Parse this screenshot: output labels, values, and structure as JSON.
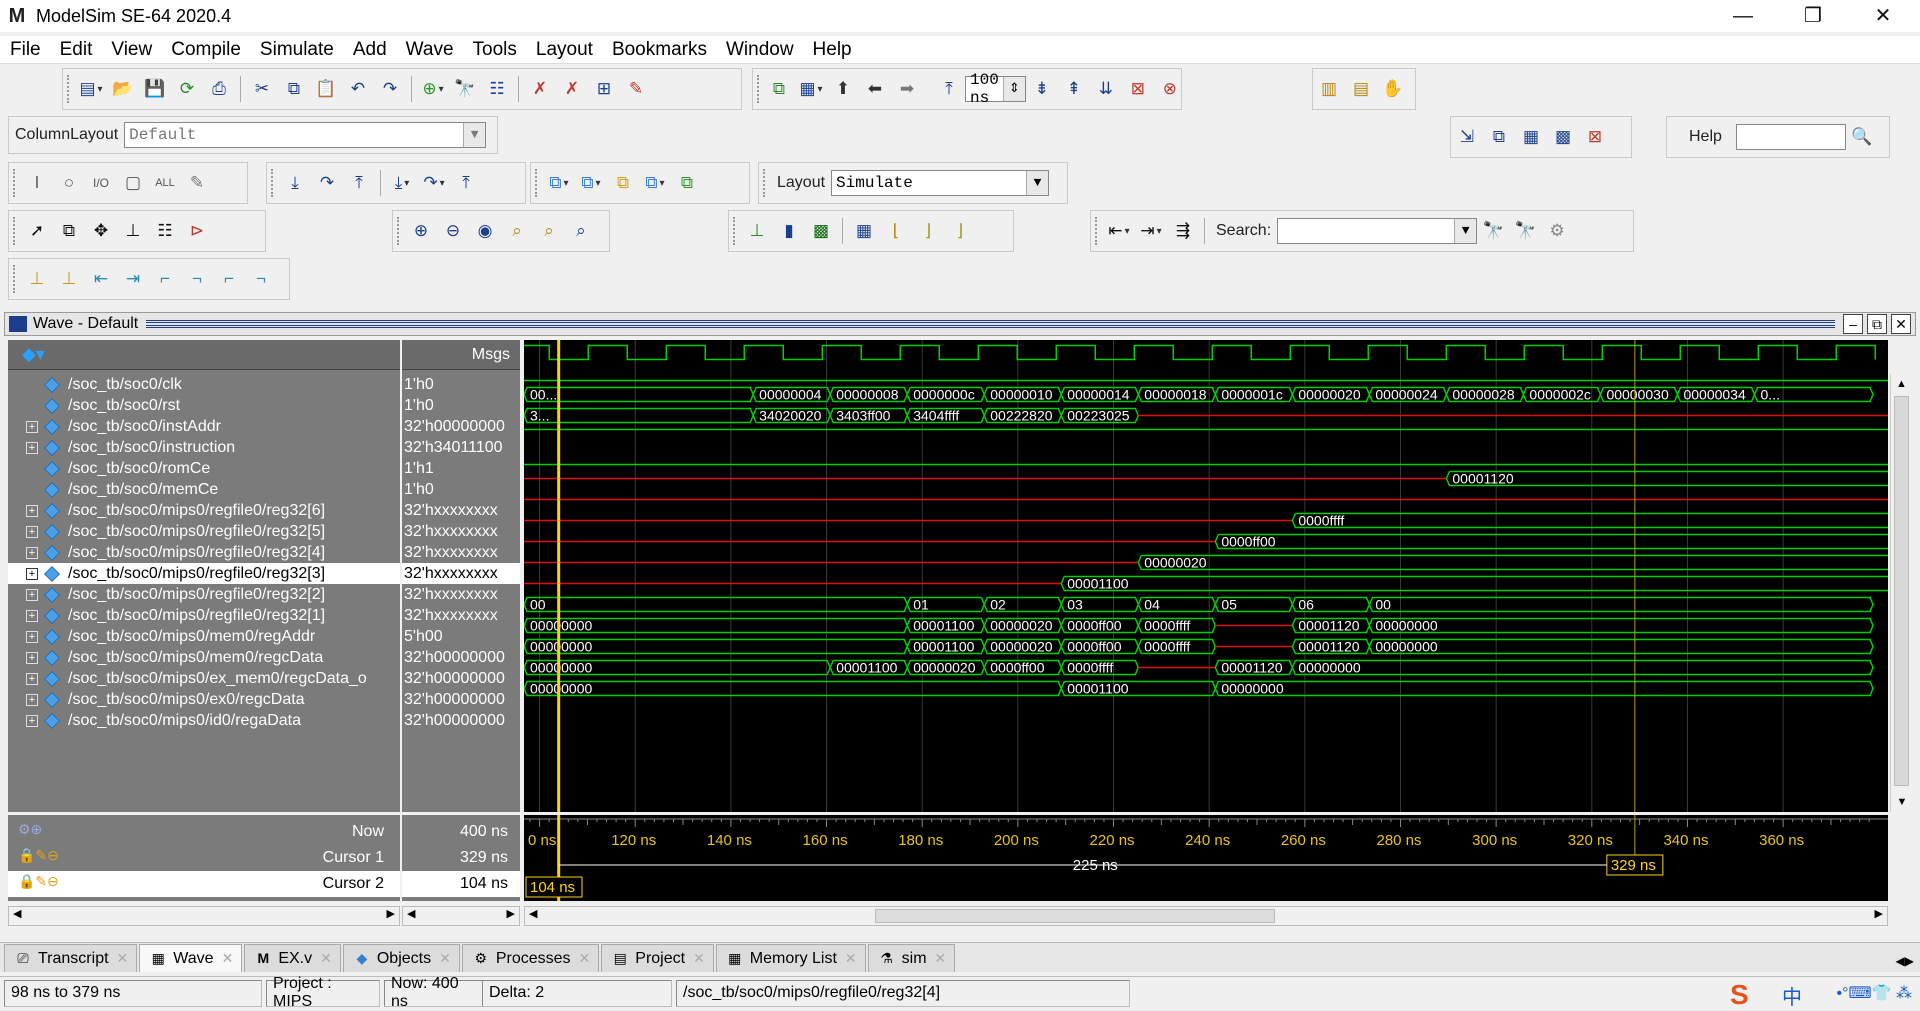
{
  "window": {
    "title": "ModelSim SE-64 2020.4"
  },
  "menu": [
    "File",
    "Edit",
    "View",
    "Compile",
    "Simulate",
    "Add",
    "Wave",
    "Tools",
    "Layout",
    "Bookmarks",
    "Window",
    "Help"
  ],
  "toolbar": {
    "run_length": "100 ns",
    "column_layout_label": "ColumnLayout",
    "column_layout_value": "Default",
    "layout_label": "Layout",
    "layout_value": "Simulate",
    "search_label": "Search:",
    "search_value": "",
    "help_label": "Help",
    "help_value": ""
  },
  "wave_window": {
    "title": "Wave - Default",
    "msgs_header": "Msgs",
    "signals": [
      {
        "name": "/soc_tb/soc0/clk",
        "value": "1'h0",
        "expandable": false
      },
      {
        "name": "/soc_tb/soc0/rst",
        "value": "1'h0",
        "expandable": false
      },
      {
        "name": "/soc_tb/soc0/instAddr",
        "value": "32'h00000000",
        "expandable": true
      },
      {
        "name": "/soc_tb/soc0/instruction",
        "value": "32'h34011100",
        "expandable": true
      },
      {
        "name": "/soc_tb/soc0/romCe",
        "value": "1'h1",
        "expandable": false
      },
      {
        "name": "/soc_tb/soc0/memCe",
        "value": "1'h0",
        "expandable": false
      },
      {
        "name": "/soc_tb/soc0/mips0/regfile0/reg32[6]",
        "value": "32'hxxxxxxxx",
        "expandable": true
      },
      {
        "name": "/soc_tb/soc0/mips0/regfile0/reg32[5]",
        "value": "32'hxxxxxxxx",
        "expandable": true
      },
      {
        "name": "/soc_tb/soc0/mips0/regfile0/reg32[4]",
        "value": "32'hxxxxxxxx",
        "expandable": true
      },
      {
        "name": "/soc_tb/soc0/mips0/regfile0/reg32[3]",
        "value": "32'hxxxxxxxx",
        "expandable": true,
        "selected": true
      },
      {
        "name": "/soc_tb/soc0/mips0/regfile0/reg32[2]",
        "value": "32'hxxxxxxxx",
        "expandable": true
      },
      {
        "name": "/soc_tb/soc0/mips0/regfile0/reg32[1]",
        "value": "32'hxxxxxxxx",
        "expandable": true
      },
      {
        "name": "/soc_tb/soc0/mips0/mem0/regAddr",
        "value": "5'h00",
        "expandable": true
      },
      {
        "name": "/soc_tb/soc0/mips0/mem0/regcData",
        "value": "32'h00000000",
        "expandable": true
      },
      {
        "name": "/soc_tb/soc0/mips0/ex_mem0/regcData_o",
        "value": "32'h00000000",
        "expandable": true
      },
      {
        "name": "/soc_tb/soc0/mips0/ex0/regcData",
        "value": "32'h00000000",
        "expandable": true
      },
      {
        "name": "/soc_tb/soc0/mips0/id0/regaData",
        "value": "32'h00000000",
        "expandable": true
      }
    ],
    "waves": [
      {
        "kind": "clock"
      },
      {
        "kind": "low"
      },
      {
        "kind": "bus",
        "color": "green",
        "segs": [
          [
            -10,
            113,
            "00..."
          ],
          [
            113,
            152,
            "00000004"
          ],
          [
            152,
            191,
            "00000008"
          ],
          [
            191,
            230,
            "0000000c"
          ],
          [
            230,
            269,
            "00000010"
          ],
          [
            269,
            308,
            "00000014"
          ],
          [
            308,
            347,
            "00000018"
          ],
          [
            347,
            386,
            "0000001c"
          ],
          [
            386,
            425,
            "00000020"
          ],
          [
            425,
            464,
            "00000024"
          ],
          [
            464,
            503,
            "00000028"
          ],
          [
            503,
            542,
            "0000002c"
          ],
          [
            542,
            581,
            "00000030"
          ],
          [
            581,
            620,
            "00000034"
          ],
          [
            620,
            680,
            "0..."
          ]
        ]
      },
      {
        "kind": "bus",
        "color": "green",
        "segs": [
          [
            -10,
            113,
            "3..."
          ],
          [
            113,
            152,
            "34020020"
          ],
          [
            152,
            191,
            "3403ff00"
          ],
          [
            191,
            230,
            "3404ffff"
          ],
          [
            230,
            269,
            "00222820"
          ],
          [
            269,
            308,
            "00223025"
          ]
        ],
        "tail": "red",
        "tail_from": 308
      },
      {
        "kind": "high"
      },
      {
        "kind": "low"
      },
      {
        "kind": "bus",
        "color": "red",
        "segs": [],
        "tail": "green",
        "tail_from": 464,
        "tail_label": "00001120"
      },
      {
        "kind": "bus",
        "color": "red",
        "segs": []
      },
      {
        "kind": "bus",
        "color": "red",
        "segs": [],
        "tail": "green",
        "tail_from": 386,
        "tail_label": "0000ffff"
      },
      {
        "kind": "bus",
        "color": "red",
        "segs": [],
        "tail": "green",
        "tail_from": 347,
        "tail_label": "0000ff00"
      },
      {
        "kind": "bus",
        "color": "red",
        "segs": [],
        "tail": "green",
        "tail_from": 308,
        "tail_label": "00000020"
      },
      {
        "kind": "bus",
        "color": "red",
        "segs": [],
        "tail": "green",
        "tail_from": 269,
        "tail_label": "00001100"
      },
      {
        "kind": "bus",
        "color": "green",
        "segs": [
          [
            -10,
            191,
            "00"
          ],
          [
            191,
            230,
            "01"
          ],
          [
            230,
            269,
            "02"
          ],
          [
            269,
            308,
            "03"
          ],
          [
            308,
            347,
            "04"
          ],
          [
            347,
            386,
            "05"
          ],
          [
            386,
            425,
            "06"
          ],
          [
            425,
            680,
            "00"
          ]
        ]
      },
      {
        "kind": "bus",
        "color": "green",
        "segs": [
          [
            -10,
            191,
            "00000000"
          ],
          [
            191,
            230,
            "00001100"
          ],
          [
            230,
            269,
            "00000020"
          ],
          [
            269,
            308,
            "0000ff00"
          ],
          [
            308,
            347,
            "0000ffff"
          ],
          [
            347,
            386,
            "",
            "red"
          ],
          [
            386,
            425,
            "00001120"
          ],
          [
            425,
            680,
            "00000000"
          ]
        ]
      },
      {
        "kind": "bus",
        "color": "green",
        "segs": [
          [
            -10,
            191,
            "00000000"
          ],
          [
            191,
            230,
            "00001100"
          ],
          [
            230,
            269,
            "00000020"
          ],
          [
            269,
            308,
            "0000ff00"
          ],
          [
            308,
            347,
            "0000ffff"
          ],
          [
            347,
            386,
            "",
            "red"
          ],
          [
            386,
            425,
            "00001120"
          ],
          [
            425,
            680,
            "00000000"
          ]
        ]
      },
      {
        "kind": "bus",
        "color": "green",
        "segs": [
          [
            -10,
            152,
            "00000000"
          ],
          [
            152,
            191,
            "00001100"
          ],
          [
            191,
            230,
            "00000020"
          ],
          [
            230,
            269,
            "0000ff00"
          ],
          [
            269,
            308,
            "0000ffff"
          ],
          [
            308,
            347,
            "",
            "red"
          ],
          [
            347,
            386,
            "00001120"
          ],
          [
            386,
            680,
            "00000000"
          ]
        ]
      },
      {
        "kind": "bus",
        "color": "green",
        "segs": [
          [
            -10,
            269,
            "00000000"
          ],
          [
            269,
            347,
            "00001100"
          ],
          [
            347,
            680,
            "00000000"
          ]
        ]
      }
    ],
    "cursors": {
      "now_label": "Now",
      "now_value": "400 ns",
      "cursor1_label": "Cursor 1",
      "cursor1_value": "329 ns",
      "cursor2_label": "Cursor 2",
      "cursor2_value": "104 ns",
      "cursor1_flag": "329 ns",
      "cursor2_flag": "104 ns",
      "delta_label": "225 ns"
    },
    "timeline": {
      "ticks": [
        "0 ns",
        "120 ns",
        "140 ns",
        "160 ns",
        "180 ns",
        "200 ns",
        "220 ns",
        "240 ns",
        "260 ns",
        "280 ns",
        "300 ns",
        "320 ns",
        "340 ns",
        "360 ns"
      ],
      "tick_times": [
        100,
        120,
        140,
        160,
        180,
        200,
        220,
        240,
        260,
        280,
        300,
        320,
        340,
        360
      ],
      "view_start": 98,
      "view_end": 379,
      "cursor1_time": 329,
      "cursor2_time": 104
    }
  },
  "tabs": [
    {
      "label": "Transcript",
      "active": false
    },
    {
      "label": "Wave",
      "active": true
    },
    {
      "label": "EX.v",
      "active": false
    },
    {
      "label": "Objects",
      "active": false
    },
    {
      "label": "Processes",
      "active": false
    },
    {
      "label": "Project",
      "active": false
    },
    {
      "label": "Memory List",
      "active": false
    },
    {
      "label": "sim",
      "active": false
    }
  ],
  "status": {
    "range": "98 ns to 379 ns",
    "project": "Project : MIPS",
    "now": "Now: 400 ns",
    "delta": "Delta: 2",
    "path": "/soc_tb/soc0/mips0/regfile0/reg32[4]",
    "ime": "中"
  }
}
